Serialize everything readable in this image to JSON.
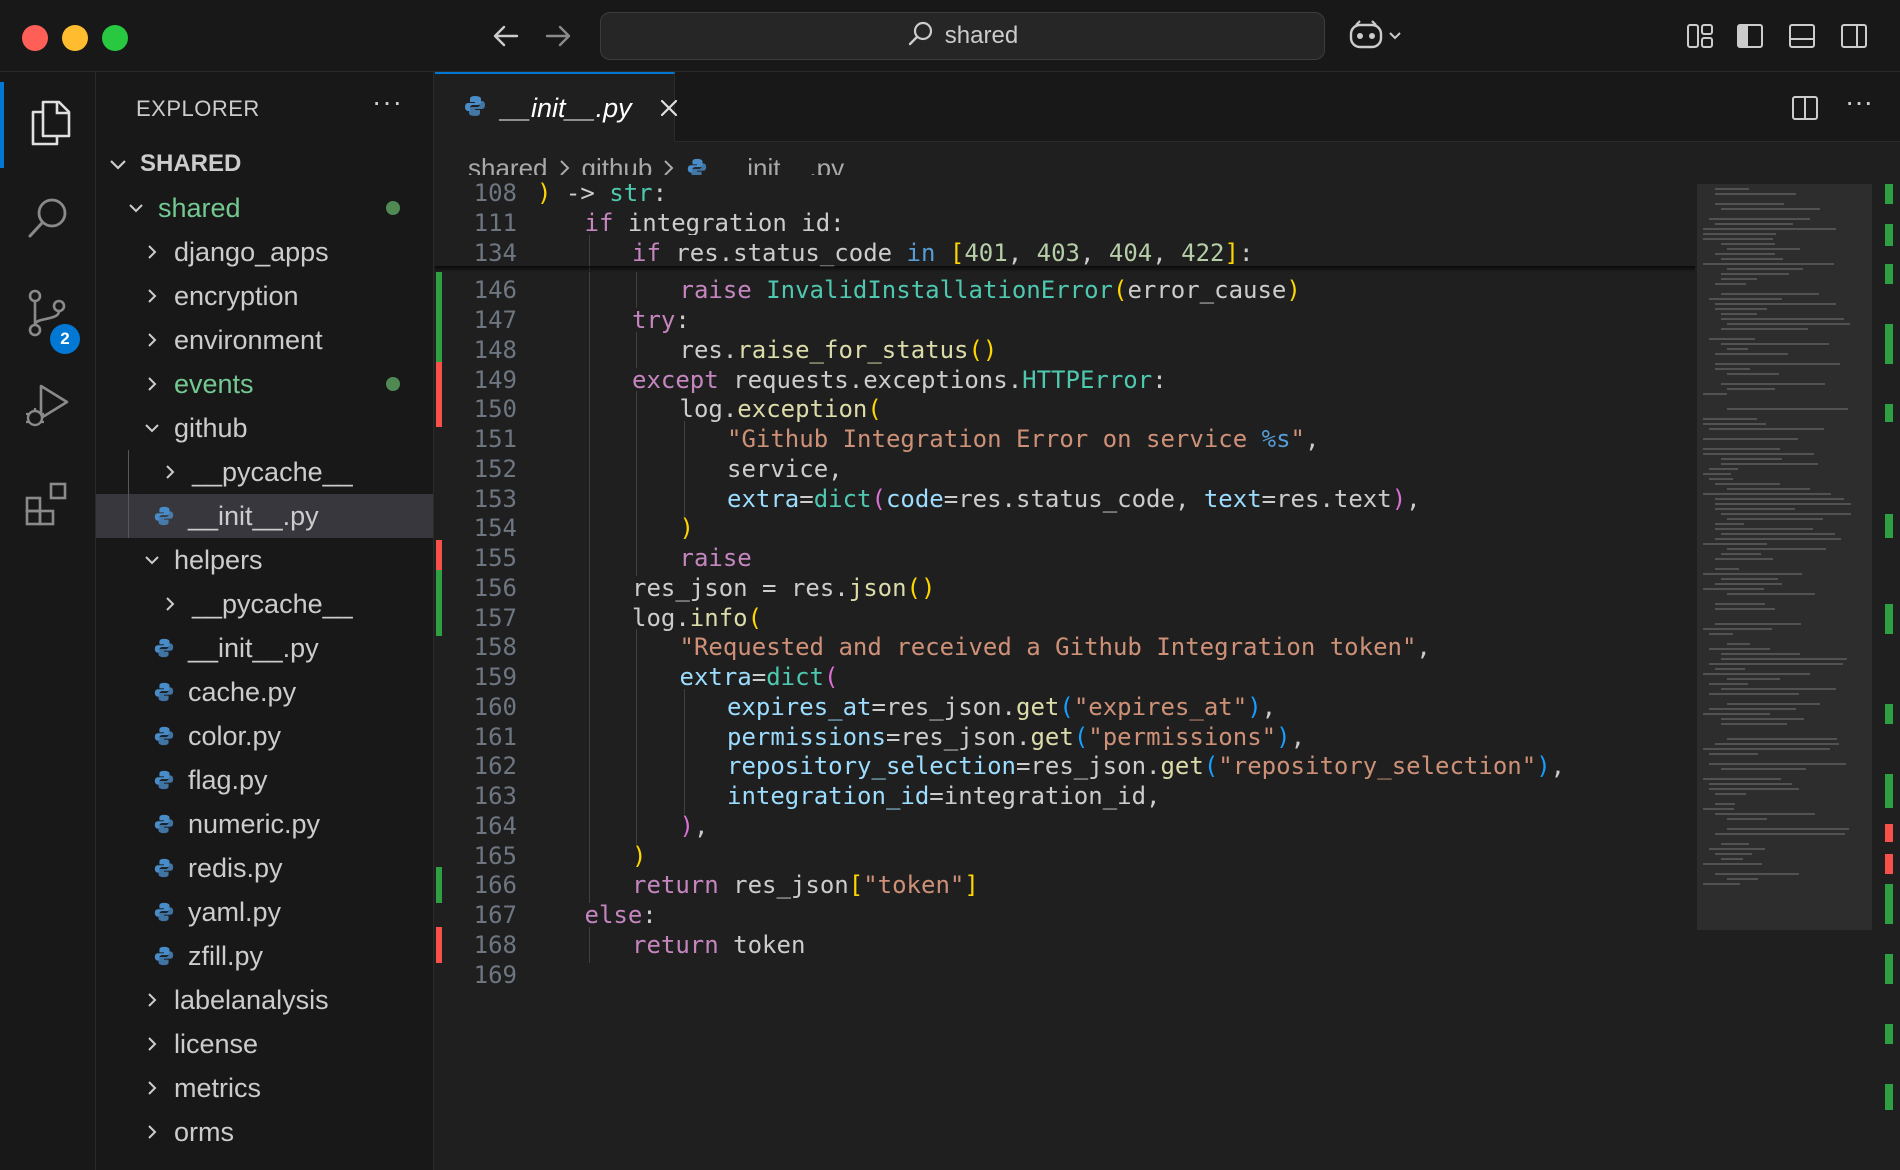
{
  "titlebar": {
    "search_text": "shared"
  },
  "activity": {
    "scm_badge": "2"
  },
  "explorer": {
    "title": "EXPLORER",
    "more": "···",
    "section": "SHARED",
    "items": [
      {
        "label": "shared",
        "type": "folder-open",
        "level": 1,
        "modified": true
      },
      {
        "label": "django_apps",
        "type": "folder",
        "level": 2
      },
      {
        "label": "encryption",
        "type": "folder",
        "level": 2
      },
      {
        "label": "environment",
        "type": "folder",
        "level": 2
      },
      {
        "label": "events",
        "type": "folder",
        "level": 2,
        "modified": true
      },
      {
        "label": "github",
        "type": "folder-open",
        "level": 2
      },
      {
        "label": "__pycache__",
        "type": "folder",
        "level": 3
      },
      {
        "label": "__init__.py",
        "type": "file",
        "level": 3,
        "selected": true
      },
      {
        "label": "helpers",
        "type": "folder-open",
        "level": 2
      },
      {
        "label": "__pycache__",
        "type": "folder",
        "level": 3
      },
      {
        "label": "__init__.py",
        "type": "file",
        "level": 3
      },
      {
        "label": "cache.py",
        "type": "file",
        "level": 3
      },
      {
        "label": "color.py",
        "type": "file",
        "level": 3
      },
      {
        "label": "flag.py",
        "type": "file",
        "level": 3
      },
      {
        "label": "numeric.py",
        "type": "file",
        "level": 3
      },
      {
        "label": "redis.py",
        "type": "file",
        "level": 3
      },
      {
        "label": "yaml.py",
        "type": "file",
        "level": 3
      },
      {
        "label": "zfill.py",
        "type": "file",
        "level": 3
      },
      {
        "label": "labelanalysis",
        "type": "folder",
        "level": 2
      },
      {
        "label": "license",
        "type": "folder",
        "level": 2
      },
      {
        "label": "metrics",
        "type": "folder",
        "level": 2
      },
      {
        "label": "orms",
        "type": "folder",
        "level": 2
      }
    ]
  },
  "editor": {
    "tab_label": "__init__.py",
    "editor_more": "···",
    "breadcrumb": [
      "shared",
      "github",
      "__init__.py"
    ],
    "lines": [
      {
        "n": "108",
        "indent": 0,
        "tokens": [
          [
            "br1",
            ")"
          ],
          [
            "",
            " -> "
          ],
          [
            "cls",
            "str"
          ],
          [
            "",
            ":"
          ]
        ]
      },
      {
        "n": "111",
        "indent": 1,
        "tokens": [
          [
            "kw",
            "if"
          ],
          [
            "",
            " integration_id:"
          ]
        ]
      },
      {
        "n": "134",
        "indent": 2,
        "tokens": [
          [
            "kw",
            "if"
          ],
          [
            "",
            " res.status_code "
          ],
          [
            "kwb",
            "in"
          ],
          [
            "",
            " "
          ],
          [
            "br1",
            "["
          ],
          [
            "num",
            "401"
          ],
          [
            "",
            ", "
          ],
          [
            "num",
            "403"
          ],
          [
            "",
            ", "
          ],
          [
            "num",
            "404"
          ],
          [
            "",
            ", "
          ],
          [
            "num",
            "422"
          ],
          [
            "br1",
            "]"
          ],
          [
            "",
            ":"
          ]
        ]
      },
      {
        "n": "146",
        "indent": 3,
        "tokens": [
          [
            "kw",
            "raise"
          ],
          [
            "",
            " "
          ],
          [
            "cls",
            "InvalidInstallationError"
          ],
          [
            "br1",
            "("
          ],
          [
            "",
            "error_cause"
          ],
          [
            "br1",
            ")"
          ]
        ]
      },
      {
        "n": "147",
        "indent": 2,
        "tokens": [
          [
            "kw",
            "try"
          ],
          [
            "",
            ":"
          ]
        ]
      },
      {
        "n": "148",
        "indent": 3,
        "tokens": [
          [
            "",
            "res."
          ],
          [
            "fn",
            "raise_for_status"
          ],
          [
            "br1",
            "()"
          ]
        ]
      },
      {
        "n": "149",
        "indent": 2,
        "tokens": [
          [
            "kw",
            "except"
          ],
          [
            "",
            " requests.exceptions."
          ],
          [
            "cls",
            "HTTPError"
          ],
          [
            "",
            ":"
          ]
        ]
      },
      {
        "n": "150",
        "indent": 3,
        "tokens": [
          [
            "",
            "log."
          ],
          [
            "fn",
            "exception"
          ],
          [
            "br1",
            "("
          ]
        ]
      },
      {
        "n": "151",
        "indent": 4,
        "tokens": [
          [
            "str",
            "\"Github Integration Error on service "
          ],
          [
            "fmt",
            "%s"
          ],
          [
            "str",
            "\""
          ],
          [
            "",
            ","
          ]
        ]
      },
      {
        "n": "152",
        "indent": 4,
        "tokens": [
          [
            "",
            "service,"
          ]
        ]
      },
      {
        "n": "153",
        "indent": 4,
        "tokens": [
          [
            "prm",
            "extra"
          ],
          [
            "",
            "="
          ],
          [
            "cls",
            "dict"
          ],
          [
            "br2",
            "("
          ],
          [
            "prm",
            "code"
          ],
          [
            "",
            "=res.status_code, "
          ],
          [
            "prm",
            "text"
          ],
          [
            "",
            "=res.text"
          ],
          [
            "br2",
            ")"
          ],
          [
            "",
            ","
          ]
        ]
      },
      {
        "n": "154",
        "indent": 3,
        "tokens": [
          [
            "br1",
            ")"
          ]
        ]
      },
      {
        "n": "155",
        "indent": 3,
        "tokens": [
          [
            "kw",
            "raise"
          ]
        ]
      },
      {
        "n": "156",
        "indent": 2,
        "tokens": [
          [
            "",
            "res_json = res."
          ],
          [
            "fn",
            "json"
          ],
          [
            "br1",
            "()"
          ]
        ]
      },
      {
        "n": "157",
        "indent": 2,
        "tokens": [
          [
            "",
            "log."
          ],
          [
            "fn",
            "info"
          ],
          [
            "br1",
            "("
          ]
        ]
      },
      {
        "n": "158",
        "indent": 3,
        "tokens": [
          [
            "str",
            "\"Requested and received a Github Integration token\""
          ],
          [
            "",
            ","
          ]
        ]
      },
      {
        "n": "159",
        "indent": 3,
        "tokens": [
          [
            "prm",
            "extra"
          ],
          [
            "",
            "="
          ],
          [
            "cls",
            "dict"
          ],
          [
            "br2",
            "("
          ]
        ]
      },
      {
        "n": "160",
        "indent": 4,
        "tokens": [
          [
            "prm",
            "expires_at"
          ],
          [
            "",
            "=res_json."
          ],
          [
            "fn",
            "get"
          ],
          [
            "br3",
            "("
          ],
          [
            "str",
            "\"expires_at\""
          ],
          [
            "br3",
            ")"
          ],
          [
            "",
            ","
          ]
        ]
      },
      {
        "n": "161",
        "indent": 4,
        "tokens": [
          [
            "prm",
            "permissions"
          ],
          [
            "",
            "=res_json."
          ],
          [
            "fn",
            "get"
          ],
          [
            "br3",
            "("
          ],
          [
            "str",
            "\"permissions\""
          ],
          [
            "br3",
            ")"
          ],
          [
            "",
            ","
          ]
        ]
      },
      {
        "n": "162",
        "indent": 4,
        "tokens": [
          [
            "prm",
            "repository_selection"
          ],
          [
            "",
            "=res_json."
          ],
          [
            "fn",
            "get"
          ],
          [
            "br3",
            "("
          ],
          [
            "str",
            "\"repository_selection\""
          ],
          [
            "br3",
            ")"
          ],
          [
            "",
            ","
          ]
        ]
      },
      {
        "n": "163",
        "indent": 4,
        "tokens": [
          [
            "prm",
            "integration_id"
          ],
          [
            "",
            "=integration_id,"
          ]
        ]
      },
      {
        "n": "164",
        "indent": 3,
        "tokens": [
          [
            "br2",
            ")"
          ],
          [
            "",
            ","
          ]
        ]
      },
      {
        "n": "165",
        "indent": 2,
        "tokens": [
          [
            "br1",
            ")"
          ]
        ]
      },
      {
        "n": "166",
        "indent": 2,
        "tokens": [
          [
            "kw",
            "return"
          ],
          [
            "",
            " res_json"
          ],
          [
            "br1",
            "["
          ],
          [
            "str",
            "\"token\""
          ],
          [
            "br1",
            "]"
          ]
        ]
      },
      {
        "n": "167",
        "indent": 1,
        "tokens": [
          [
            "kw",
            "else"
          ],
          [
            "",
            ":"
          ]
        ]
      },
      {
        "n": "168",
        "indent": 2,
        "tokens": [
          [
            "kw",
            "return"
          ],
          [
            "",
            " token"
          ]
        ]
      },
      {
        "n": "169",
        "indent": 0,
        "tokens": []
      }
    ],
    "gutter_marks": [
      {
        "line": "146",
        "color": "#2ea043"
      },
      {
        "line": "147",
        "color": "#2ea043"
      },
      {
        "line": "148",
        "color": "#2ea043"
      },
      {
        "line": "149",
        "color": "#f85149"
      },
      {
        "line": "150",
        "color": "#f85149"
      },
      {
        "line": "155",
        "color": "#f85149"
      },
      {
        "line": "156",
        "color": "#2ea043"
      },
      {
        "line": "157",
        "color": "#2ea043"
      },
      {
        "line": "166",
        "color": "#2ea043"
      },
      {
        "line": "168",
        "color": "#f85149"
      }
    ]
  },
  "colors": {
    "accent": "#0078d4",
    "added": "#2ea043",
    "deleted": "#f85149"
  }
}
